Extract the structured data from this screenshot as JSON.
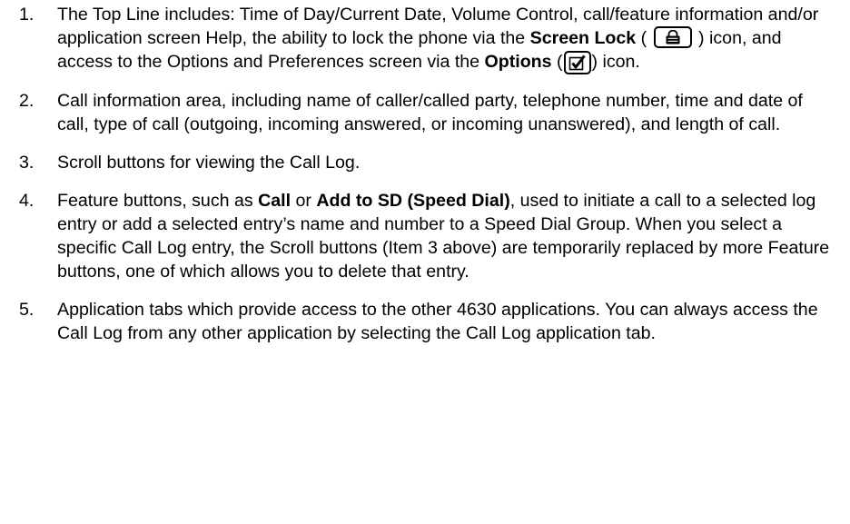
{
  "items": [
    {
      "num": "1.",
      "t1": "The Top Line includes: Time of Day/Current Date, Volume Control, call/feature information and/or application screen Help, the ability to lock the phone via the ",
      "b1": "Screen Lock",
      "t2": " ( ",
      "t3": " ) icon, and access to the Options and Preferences screen via the ",
      "b2": "Options",
      "t4": " (",
      "t5": ") icon."
    },
    {
      "num": "2.",
      "text": "Call information area, including name of caller/called party, telephone number, time and date of call, type of call (outgoing, incoming answered, or incoming unanswered), and length of call."
    },
    {
      "num": "3.",
      "text": "Scroll buttons for viewing the Call Log."
    },
    {
      "num": "4.",
      "t1": "Feature buttons, such as ",
      "b1": "Call",
      "t2": " or ",
      "b2": "Add to SD (Speed Dial)",
      "t3": ", used to initiate a call to a selected log entry or add a selected entry’s name and number to a Speed Dial Group. When you select a specific Call Log entry, the Scroll buttons (Item 3 above) are temporarily replaced by more Feature buttons, one of which allows you to delete that entry."
    },
    {
      "num": "5.",
      "text": "Application tabs which provide access to the other 4630 applications. You can always access the Call Log from any other application by selecting the Call Log application tab."
    }
  ],
  "icons": {
    "screen_lock": "lock-icon",
    "options": "checkbox-icon"
  }
}
